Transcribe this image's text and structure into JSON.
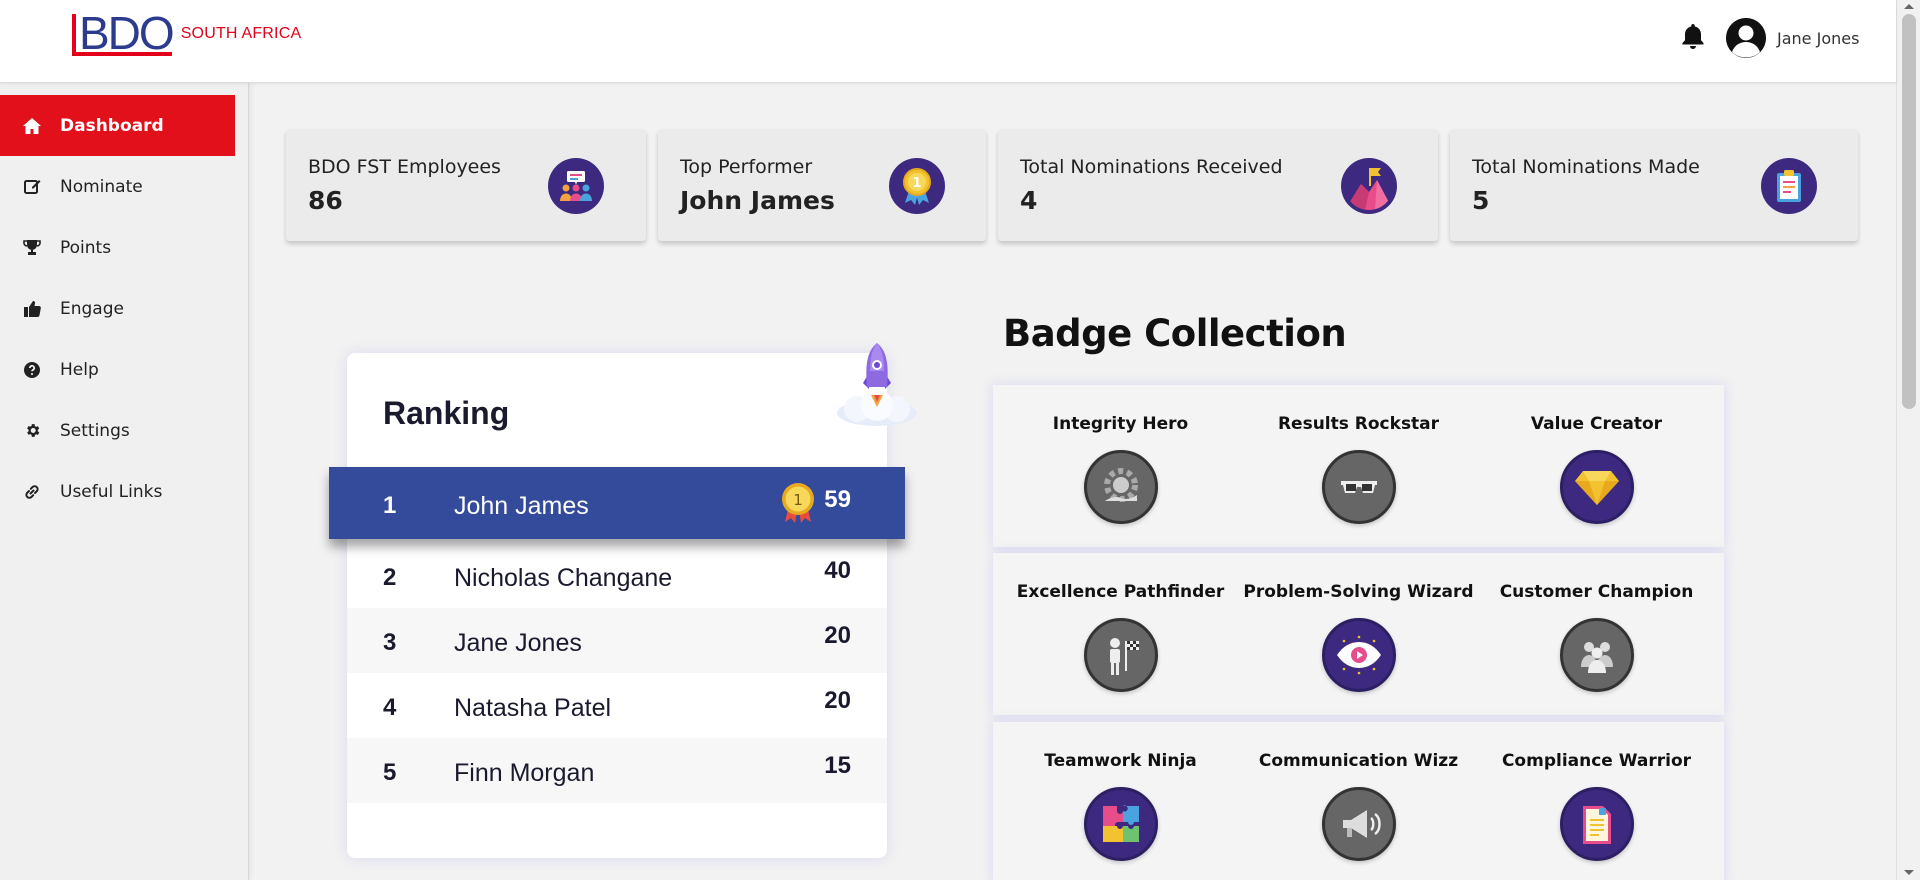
{
  "header": {
    "logo_text": "BDO",
    "logo_region": "SOUTH AFRICA",
    "user_name": "Jane Jones"
  },
  "sidebar": {
    "items": [
      {
        "label": "Dashboard",
        "icon": "home-icon",
        "active": true
      },
      {
        "label": "Nominate",
        "icon": "edit-icon",
        "active": false
      },
      {
        "label": "Points",
        "icon": "trophy-icon",
        "active": false
      },
      {
        "label": "Engage",
        "icon": "thumbs-up-icon",
        "active": false
      },
      {
        "label": "Help",
        "icon": "help-circle-icon",
        "active": false
      },
      {
        "label": "Settings",
        "icon": "gear-icon",
        "active": false
      },
      {
        "label": "Useful Links",
        "icon": "link-icon",
        "active": false
      }
    ]
  },
  "stats": [
    {
      "label": "BDO FST Employees",
      "value": "86",
      "icon": "people-meeting-icon"
    },
    {
      "label": "Top Performer",
      "value": "John James",
      "icon": "medal-icon"
    },
    {
      "label": "Total Nominations Received",
      "value": "4",
      "icon": "mountain-flag-icon"
    },
    {
      "label": "Total Nominations Made",
      "value": "5",
      "icon": "clipboard-icon"
    }
  ],
  "ranking": {
    "title": "Ranking",
    "rows": [
      {
        "rank": "1",
        "name": "John James",
        "points": "59"
      },
      {
        "rank": "2",
        "name": "Nicholas Changane",
        "points": "40"
      },
      {
        "rank": "3",
        "name": "Jane Jones",
        "points": "20"
      },
      {
        "rank": "4",
        "name": "Natasha Patel",
        "points": "20"
      },
      {
        "rank": "5",
        "name": "Finn Morgan",
        "points": "15"
      }
    ]
  },
  "badges": {
    "title": "Badge Collection",
    "items": [
      {
        "name": "Integrity Hero",
        "icon": "gear-hand-icon",
        "earned": false
      },
      {
        "name": "Results Rockstar",
        "icon": "sunglasses-icon",
        "earned": false
      },
      {
        "name": "Value Creator",
        "icon": "diamond-icon",
        "earned": true
      },
      {
        "name": "Excellence Pathfinder",
        "icon": "flag-person-icon",
        "earned": false
      },
      {
        "name": "Problem-Solving Wizard",
        "icon": "eye-icon",
        "earned": true
      },
      {
        "name": "Customer Champion",
        "icon": "team-icon",
        "earned": false
      },
      {
        "name": "Teamwork Ninja",
        "icon": "puzzle-icon",
        "earned": true
      },
      {
        "name": "Communication Wizz",
        "icon": "megaphone-icon",
        "earned": false
      },
      {
        "name": "Compliance Warrior",
        "icon": "document-icon",
        "earned": true
      }
    ]
  },
  "colors": {
    "brand_red": "#e2001a",
    "brand_blue": "#2d3b8f",
    "ranking_highlight": "#344a9b",
    "icon_purple": "#3d2a80"
  }
}
